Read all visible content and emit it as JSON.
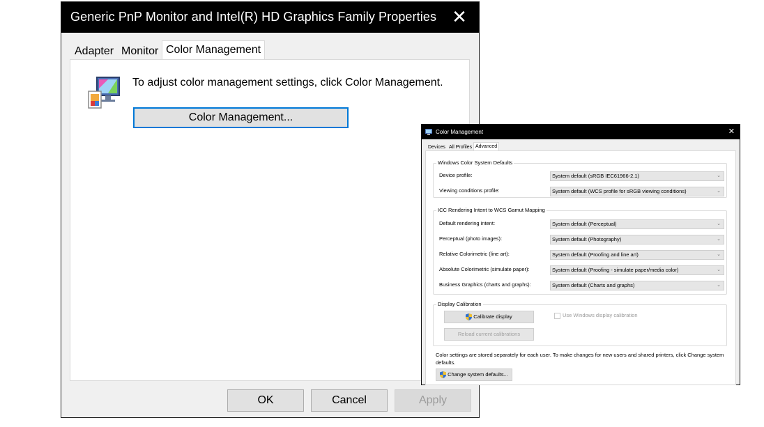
{
  "properties_dialog": {
    "title": "Generic PnP Monitor and Intel(R) HD Graphics Family Properties",
    "close_glyph": "✕",
    "tabs": [
      "Adapter",
      "Monitor",
      "Color Management"
    ],
    "active_tab": "Color Management",
    "icon": "monitor-color-icon",
    "instruction": "To adjust color management settings, click Color Management.",
    "color_management_button": "Color Management...",
    "buttons": {
      "ok": "OK",
      "cancel": "Cancel",
      "apply": "Apply"
    }
  },
  "color_management_dialog": {
    "title": "Color Management",
    "close_glyph": "✕",
    "tabs": [
      "Devices",
      "All Profiles",
      "Advanced"
    ],
    "active_tab": "Advanced",
    "wcs_group": {
      "title": "Windows Color System Defaults",
      "rows": [
        {
          "label": "Device profile:",
          "value": "System default (sRGB IEC61966-2.1)"
        },
        {
          "label": "Viewing conditions profile:",
          "value": "System default (WCS profile for sRGB viewing conditions)"
        }
      ]
    },
    "icc_group": {
      "title": "ICC Rendering Intent to WCS Gamut Mapping",
      "rows": [
        {
          "label": "Default rendering intent:",
          "value": "System default (Perceptual)"
        },
        {
          "label": "Perceptual (photo images):",
          "value": "System default (Photography)"
        },
        {
          "label": "Relative Colorimetric (line art):",
          "value": "System default (Proofing and line art)"
        },
        {
          "label": "Absolute Colorimetric (simulate paper):",
          "value": "System default (Proofing - simulate paper/media color)"
        },
        {
          "label": "Business Graphics (charts and graphs):",
          "value": "System default (Charts and graphs)"
        }
      ]
    },
    "calibration_group": {
      "title": "Display Calibration",
      "calibrate_button": "Calibrate display",
      "use_windows_calibration_label": "Use Windows display calibration",
      "use_windows_calibration_checked": false,
      "reload_button": "Reload current calibrations"
    },
    "note": "Color settings are stored separately for each user. To make changes for new users and shared printers, click Change system defaults.",
    "change_defaults_button": "Change system defaults..."
  },
  "colors": {
    "titlebar": "#000000",
    "focus_border": "#0078d7",
    "button_face": "#e1e1e1",
    "dialog_bg": "#f0f0f0"
  }
}
